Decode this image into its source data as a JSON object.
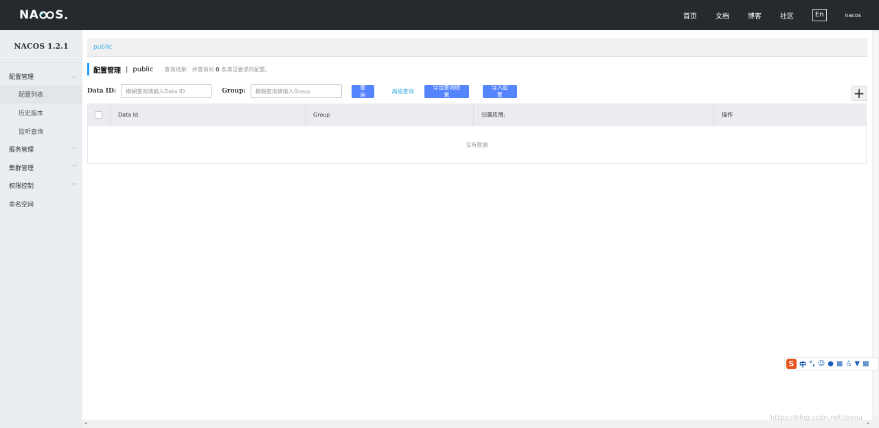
{
  "topbar": {
    "logo_left": "NA",
    "logo_right": "S",
    "nav": [
      "首页",
      "文档",
      "博客",
      "社区"
    ],
    "lang": "En",
    "user": "nacos"
  },
  "sidebar": {
    "version": "NACOS 1.2.1",
    "items": [
      {
        "label": "配置管理"
      },
      {
        "label": "配置列表"
      },
      {
        "label": "历史版本"
      },
      {
        "label": "监听查询"
      },
      {
        "label": "服务管理"
      },
      {
        "label": "集群管理"
      },
      {
        "label": "权限控制"
      },
      {
        "label": "命名空间"
      }
    ]
  },
  "namespace_bar": {
    "active": "public"
  },
  "page_head": {
    "title": "配置管理",
    "separator": "|",
    "namespace": "public",
    "summary_prefix": "查询结果：共查询到",
    "summary_count": "0",
    "summary_suffix": "条满足要求的配置。"
  },
  "filters": {
    "data_id_label": "Data ID:",
    "data_id_placeholder": "模糊查询请输入Data ID",
    "group_label": "Group:",
    "group_placeholder": "模糊查询请输入Group",
    "search_button": "查询",
    "advanced_search": "高级查询",
    "export_button": "导出查询结果",
    "import_button": "导入配置",
    "add_button": "+"
  },
  "table": {
    "columns": [
      "Data Id",
      "Group",
      "归属应用:",
      "操作"
    ],
    "empty_text": "没有数据"
  },
  "watermark": "https://blog.csdn.net/jayou"
}
